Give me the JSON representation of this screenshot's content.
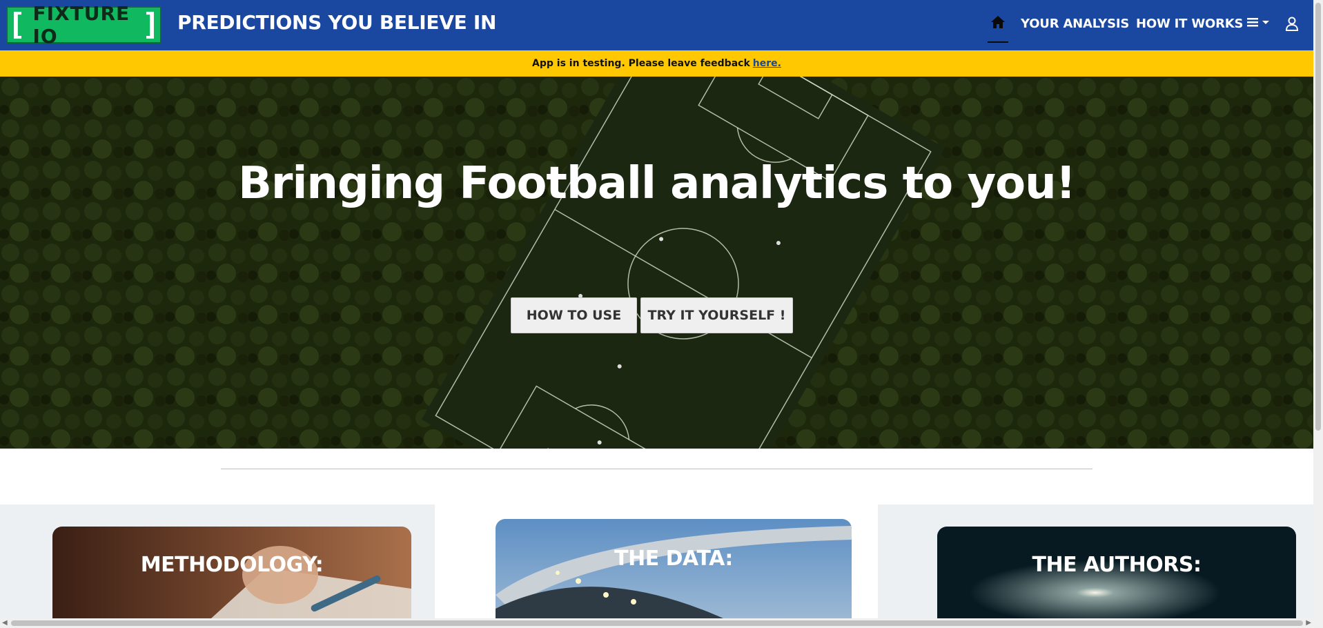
{
  "brand": {
    "logo_text": "FIXTURE IO",
    "tagline": "PREDICTIONS YOU BELIEVE IN",
    "primary_color": "#1a47a0",
    "logo_color": "#10b860"
  },
  "nav": {
    "home_icon": "home-icon",
    "links": [
      "YOUR ANALYSIS",
      "HOW IT WORKS"
    ],
    "menu_icon": "hamburger-menu-icon",
    "user_icon": "user-icon"
  },
  "banner": {
    "text": "App is in testing. Please leave feedback",
    "link": "here.",
    "color": "#ffc800"
  },
  "hero": {
    "title": "Bringing Football analytics to you!",
    "buttons": [
      "HOW TO USE",
      "TRY IT YOURSELF !"
    ]
  },
  "cards": [
    {
      "title": "METHODOLOGY:"
    },
    {
      "title": "THE DATA:"
    },
    {
      "title": "THE AUTHORS:"
    }
  ]
}
